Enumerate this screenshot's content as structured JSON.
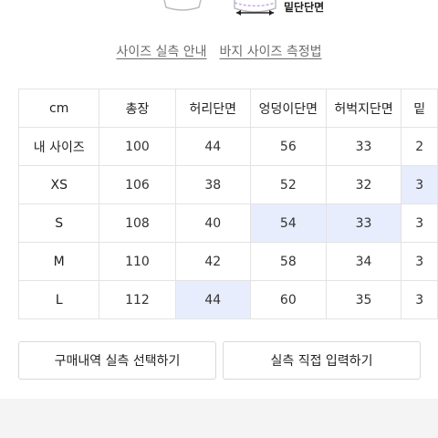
{
  "illustration": {
    "hem_label": "밑단단면"
  },
  "guide_links": {
    "actual_size_guide": "사이즈 실측 안내",
    "pants_measure_guide": "바지 사이즈 측정법"
  },
  "size_table": {
    "headers": [
      "cm",
      "총장",
      "허리단면",
      "엉덩이단면",
      "허벅지단면",
      "밑"
    ],
    "rows": [
      {
        "label": "내 사이즈",
        "values": [
          "100",
          "44",
          "56",
          "33",
          "2"
        ]
      },
      {
        "label": "XS",
        "values": [
          "106",
          "38",
          "52",
          "32",
          "3"
        ]
      },
      {
        "label": "S",
        "values": [
          "108",
          "40",
          "54",
          "33",
          "3"
        ]
      },
      {
        "label": "M",
        "values": [
          "110",
          "42",
          "58",
          "34",
          "3"
        ]
      },
      {
        "label": "L",
        "values": [
          "112",
          "44",
          "60",
          "35",
          "3"
        ]
      }
    ],
    "highlight_color": "#e8edfd"
  },
  "buttons": {
    "purchase_history": "구매내역 실측 선택하기",
    "manual_input": "실측 직접 입력하기"
  }
}
